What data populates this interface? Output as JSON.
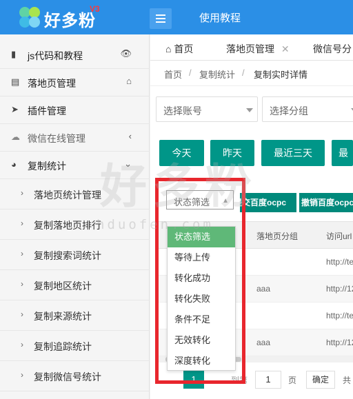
{
  "header": {
    "logo_text": "好多粉",
    "logo_badge": "V3",
    "menu_link": "使用教程",
    "brand_color": "#2b8fe6"
  },
  "sidebar": {
    "items": [
      {
        "label": "js代码和教程",
        "icon": "bookmark-icon",
        "right": "👁"
      },
      {
        "label": "落地页管理",
        "icon": "document-icon",
        "right": "⌂"
      },
      {
        "label": "插件管理",
        "icon": "send-icon",
        "right": ""
      },
      {
        "label": "微信在线管理",
        "icon": "wechat-icon",
        "right": "‹"
      },
      {
        "label": "复制统计",
        "icon": "pie-chart-icon",
        "right": "⌄"
      }
    ],
    "subitems": [
      "落地页统计管理",
      "复制落地页排行",
      "复制搜索词统计",
      "复制地区统计",
      "复制来源统计",
      "复制追踪统计",
      "复制微信号统计"
    ]
  },
  "tabs": {
    "home": "首页",
    "active": "落地页管理",
    "third": "微信号分"
  },
  "breadcrumb": {
    "a": "首页",
    "b": "复制统计",
    "c": "复制实时详情",
    "sep": "/"
  },
  "filters": {
    "account": "选择账号",
    "group": "选择分组"
  },
  "date_buttons": [
    "今天",
    "昨天",
    "最近三天",
    "最"
  ],
  "action_buttons": [
    "提交百度ocpc",
    "撤销百度ocpc"
  ],
  "table": {
    "headers": [
      "落地页分组",
      "访问url"
    ],
    "rows": [
      [
        "",
        "http://te"
      ],
      [
        "aaa",
        "http://12"
      ],
      [
        "",
        "http://te"
      ],
      [
        "aaa",
        "http://12"
      ]
    ]
  },
  "status_filter": {
    "value": "状态筛选",
    "options": [
      "状态筛选",
      "等待上传",
      "转化成功",
      "转化失败",
      "条件不足",
      "无效转化",
      "深度转化"
    ]
  },
  "pagination": {
    "current": "1",
    "goto_value": "1",
    "page_label": "页",
    "confirm": "确定",
    "total_prefix": "共",
    "to_label": "到第"
  },
  "watermark": {
    "big": "好多粉",
    "url": "hduofen.com"
  },
  "colors": {
    "teal": "#009688",
    "green_selected": "#5fb878",
    "red_highlight": "#e8262d"
  }
}
